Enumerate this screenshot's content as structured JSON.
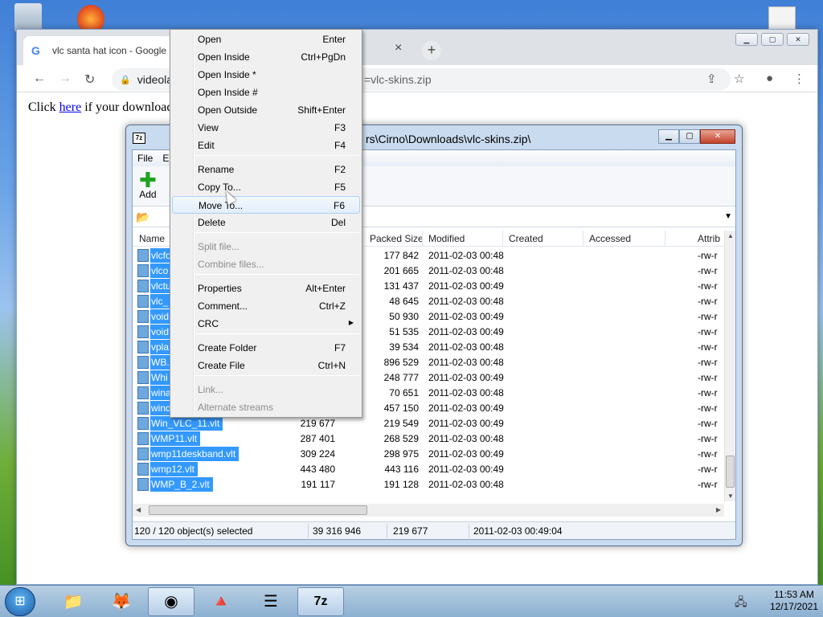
{
  "chrome": {
    "tab_title": "vlc santa hat icon - Google",
    "tab_close": "×",
    "new_tab": "+",
    "url_host": "videola",
    "url_tail": "=vlc-skins.zip",
    "page_text_before": "Click",
    "page_link": "here",
    "page_text_after": "if your download"
  },
  "sevenzip": {
    "title": "rs\\Cirno\\Downloads\\vlc-skins.zip\\",
    "logo": "7z",
    "menu": [
      "File",
      "E"
    ],
    "add_label": "Add",
    "columns": [
      "Name",
      "Packed Size",
      "Modified",
      "Created",
      "Accessed",
      "Attrib"
    ],
    "rows": [
      {
        "name": "vlcfo",
        "size": "",
        "packed": "177 842",
        "modified": "2011-02-03 00:48",
        "attrib": "-rw-r"
      },
      {
        "name": "vlco",
        "size": "",
        "packed": "201 665",
        "modified": "2011-02-03 00:48",
        "attrib": "-rw-r"
      },
      {
        "name": "vlctu",
        "size": "",
        "packed": "131 437",
        "modified": "2011-02-03 00:49",
        "attrib": "-rw-r"
      },
      {
        "name": "vlc_",
        "size": "",
        "packed": "48 645",
        "modified": "2011-02-03 00:48",
        "attrib": "-rw-r"
      },
      {
        "name": "void",
        "size": "",
        "packed": "50 930",
        "modified": "2011-02-03 00:49",
        "attrib": "-rw-r"
      },
      {
        "name": "void",
        "size": "",
        "packed": "51 535",
        "modified": "2011-02-03 00:49",
        "attrib": "-rw-r"
      },
      {
        "name": "vpla",
        "size": "",
        "packed": "39 534",
        "modified": "2011-02-03 00:48",
        "attrib": "-rw-r"
      },
      {
        "name": "WB.",
        "size": "",
        "packed": "896 529",
        "modified": "2011-02-03 00:48",
        "attrib": "-rw-r"
      },
      {
        "name": "Whi",
        "size": "",
        "packed": "248 777",
        "modified": "2011-02-03 00:49",
        "attrib": "-rw-r"
      },
      {
        "name": "wina",
        "size": "",
        "packed": "70 651",
        "modified": "2011-02-03 00:48",
        "attrib": "-rw-r"
      },
      {
        "name": "wind",
        "size": "",
        "packed": "457 150",
        "modified": "2011-02-03 00:49",
        "attrib": "-rw-r"
      },
      {
        "name": "Win_VLC_11.vlt",
        "size": "219 677",
        "packed": "219 549",
        "modified": "2011-02-03 00:49",
        "attrib": "-rw-r"
      },
      {
        "name": "WMP11.vlt",
        "size": "287 401",
        "packed": "268 529",
        "modified": "2011-02-03 00:48",
        "attrib": "-rw-r"
      },
      {
        "name": "wmp11deskband.vlt",
        "size": "309 224",
        "packed": "298 975",
        "modified": "2011-02-03 00:49",
        "attrib": "-rw-r"
      },
      {
        "name": "wmp12.vlt",
        "size": "443 480",
        "packed": "443 116",
        "modified": "2011-02-03 00:49",
        "attrib": "-rw-r"
      },
      {
        "name": "WMP_B_2.vlt",
        "size": "191 117",
        "packed": "191 128",
        "modified": "2011-02-03 00:48",
        "attrib": "-rw-r"
      }
    ],
    "status": {
      "selected": "120 / 120 object(s) selected",
      "total": "39 316 946",
      "size": "219 677",
      "date": "2011-02-03 00:49:04"
    }
  },
  "context_menu": {
    "items": [
      {
        "label": "Open",
        "key": "Enter"
      },
      {
        "label": "Open Inside",
        "key": "Ctrl+PgDn"
      },
      {
        "label": "Open Inside *",
        "key": ""
      },
      {
        "label": "Open Inside #",
        "key": ""
      },
      {
        "label": "Open Outside",
        "key": "Shift+Enter"
      },
      {
        "label": "View",
        "key": "F3"
      },
      {
        "label": "Edit",
        "key": "F4"
      },
      {
        "label": "Rename",
        "key": "F2"
      },
      {
        "label": "Copy To...",
        "key": "F5"
      },
      {
        "label": "Move To...",
        "key": "F6"
      },
      {
        "label": "Delete",
        "key": "Del"
      },
      {
        "label": "Split file...",
        "key": ""
      },
      {
        "label": "Combine files...",
        "key": ""
      },
      {
        "label": "Properties",
        "key": "Alt+Enter"
      },
      {
        "label": "Comment...",
        "key": "Ctrl+Z"
      },
      {
        "label": "CRC",
        "key": ""
      },
      {
        "label": "Create Folder",
        "key": "F7"
      },
      {
        "label": "Create File",
        "key": "Ctrl+N"
      },
      {
        "label": "Link...",
        "key": ""
      },
      {
        "label": "Alternate streams",
        "key": ""
      }
    ]
  },
  "taskbar": {
    "time": "11:53 AM",
    "date": "12/17/2021",
    "z7_label": "7z"
  },
  "colors": {
    "selection": "#3399ff",
    "menu_highlight": "#e3eefb",
    "disabled_text": "#8d8d8d"
  }
}
